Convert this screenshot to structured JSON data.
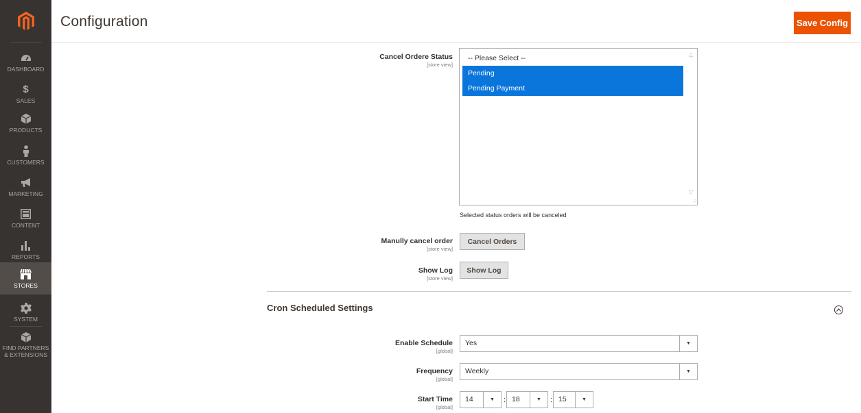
{
  "sidebar": {
    "logo_icon": "magento-logo-icon",
    "items": [
      {
        "label": "DASHBOARD",
        "icon": "dashboard-gauge-icon"
      },
      {
        "label": "SALES",
        "icon": "dollar-icon"
      },
      {
        "label": "PRODUCTS",
        "icon": "cube-icon"
      },
      {
        "label": "CUSTOMERS",
        "icon": "person-icon"
      },
      {
        "label": "MARKETING",
        "icon": "megaphone-icon"
      },
      {
        "label": "CONTENT",
        "icon": "layout-icon"
      },
      {
        "label": "REPORTS",
        "icon": "bar-chart-icon"
      },
      {
        "label": "STORES",
        "icon": "storefront-icon"
      },
      {
        "label": "SYSTEM",
        "icon": "gear-icon"
      },
      {
        "label": "FIND PARTNERS & EXTENSIONS",
        "icon": "cube-icon"
      }
    ],
    "active": "STORES"
  },
  "header": {
    "title": "Configuration",
    "save_label": "Save Config"
  },
  "cancel_status": {
    "label": "Cancel Ordere Status",
    "scope": "[store view]",
    "options": [
      {
        "label": "-- Please Select --",
        "selected": false
      },
      {
        "label": "Pending",
        "selected": true
      },
      {
        "label": "Pending Payment",
        "selected": true
      }
    ],
    "hint": "Selected status orders will be canceled"
  },
  "manual_cancel": {
    "label": "Manully cancel order",
    "scope": "[store view]",
    "button": "Cancel Orders"
  },
  "show_log": {
    "label": "Show Log",
    "scope": "[store view]",
    "button": "Show Log"
  },
  "cron_section": {
    "title": "Cron Scheduled Settings",
    "toggle_icon": "chevron-up-circle-icon",
    "enable_schedule": {
      "label": "Enable Schedule",
      "scope": "[global]",
      "value": "Yes"
    },
    "frequency": {
      "label": "Frequency",
      "scope": "[global]",
      "value": "Weekly"
    },
    "start_time": {
      "label": "Start Time",
      "scope": "[global]",
      "hour": "14",
      "minute": "18",
      "second": "15",
      "separator": ":"
    }
  },
  "colors": {
    "sidebar_bg": "#373330",
    "accent": "#eb5202",
    "selected_option": "#0a76dc"
  }
}
